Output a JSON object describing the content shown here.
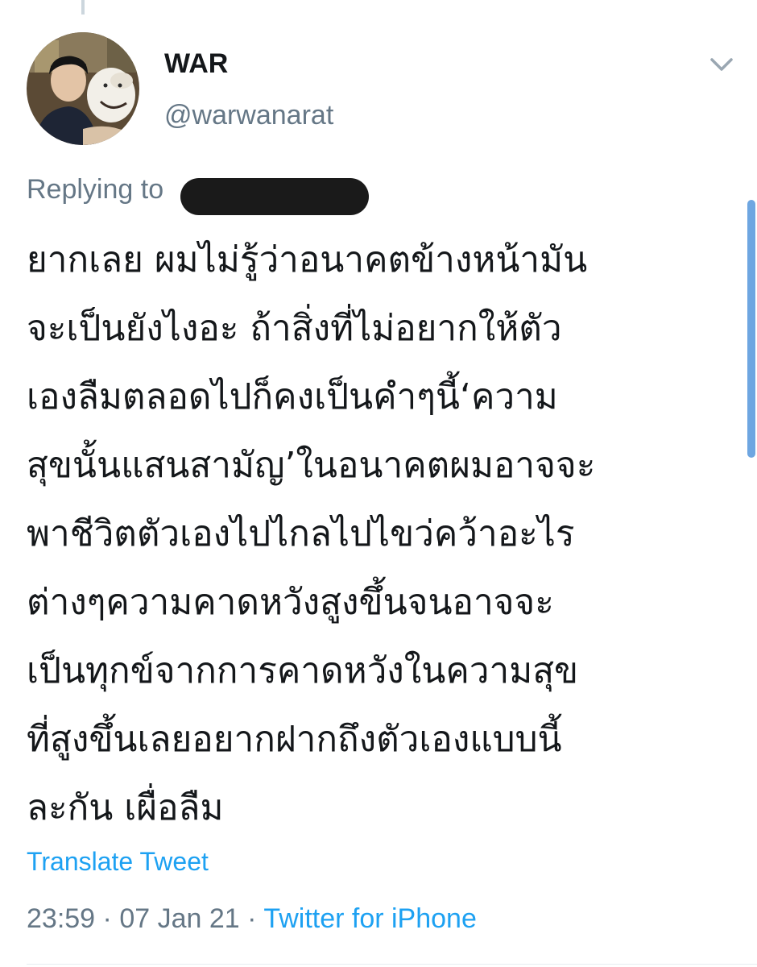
{
  "tweet": {
    "author": {
      "display_name": "WAR",
      "handle": "@warwanarat"
    },
    "replying_to_label": "Replying to",
    "text_lines": [
      "ยากเลย ผมไม่รู้ว่าอนาคตข้างหน้ามัน",
      "จะเป็นยังไงอะ ถ้าสิ่งที่ไม่อยากให้ตัว",
      "เองลืมตลอดไปก็คงเป็นคำๆนี้‘ความ",
      "สุขนั้นแสนสามัญ’ในอนาคตผมอาจจะ",
      "พาชีวิตตัวเองไปไกลไปไขว่คว้าอะไร",
      "ต่างๆความคาดหวังสูงขึ้นจนอาจจะ",
      "เป็นทุกข์จากการคาดหวังในความสุข",
      "ที่สูงขึ้นเลยอยากฝากถึงตัวเองแบบนี้",
      "ละกัน เผื่อลืม"
    ],
    "translate_label": "Translate Tweet",
    "time": "23:59",
    "date": "07 Jan 21",
    "separator": "·",
    "source": "Twitter for iPhone"
  },
  "icons": {
    "more": "chevron-down-icon",
    "avatar": "avatar"
  },
  "colors": {
    "accent": "#1da1f2",
    "secondary_text": "#657786",
    "primary_text": "#14171a"
  }
}
